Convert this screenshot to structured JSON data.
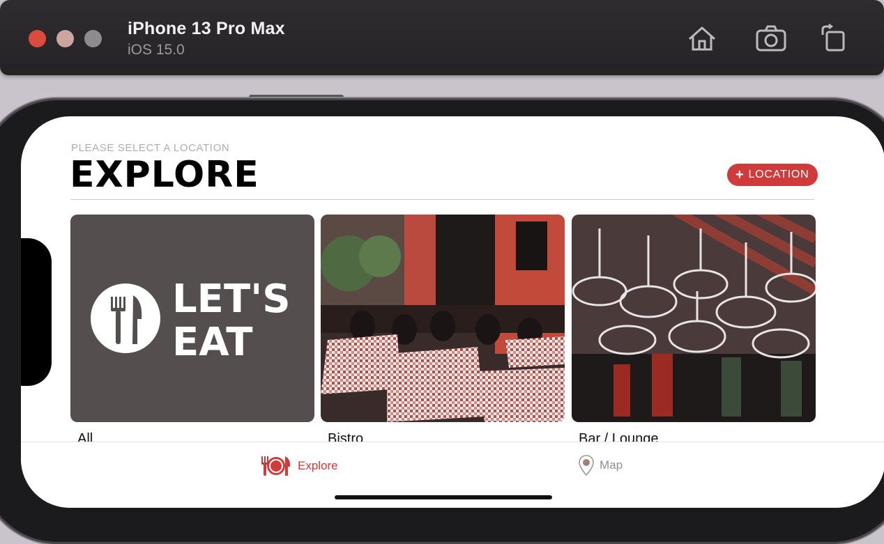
{
  "simulator": {
    "device_name": "iPhone 13 Pro Max",
    "os_version": "iOS 15.0",
    "toolbar_icons": [
      "home-icon",
      "screenshot-camera-icon",
      "rotate-icon"
    ]
  },
  "app": {
    "header": {
      "subtitle": "PLEASE SELECT A LOCATION",
      "title": "EXPLORE",
      "location_button_label": "LOCATION",
      "location_button_icon": "plus-icon"
    },
    "categories": [
      {
        "label": "All",
        "image": "lets-eat-logo"
      },
      {
        "label": "Bistro",
        "image": "bistro-photo"
      },
      {
        "label": "Bar / Lounge",
        "image": "bar-glasses-photo"
      }
    ],
    "logo_text": [
      "LET'S",
      "EAT"
    ],
    "tab_bar": {
      "tabs": [
        {
          "label": "Explore",
          "icon": "fork-plate-knife-icon",
          "selected": true
        },
        {
          "label": "Map",
          "icon": "map-pin-icon",
          "selected": false
        }
      ]
    }
  },
  "colors": {
    "accent": "#cf3a3a",
    "tab_inactive": "#8f8f8f",
    "titlebar": "#2b282b"
  }
}
